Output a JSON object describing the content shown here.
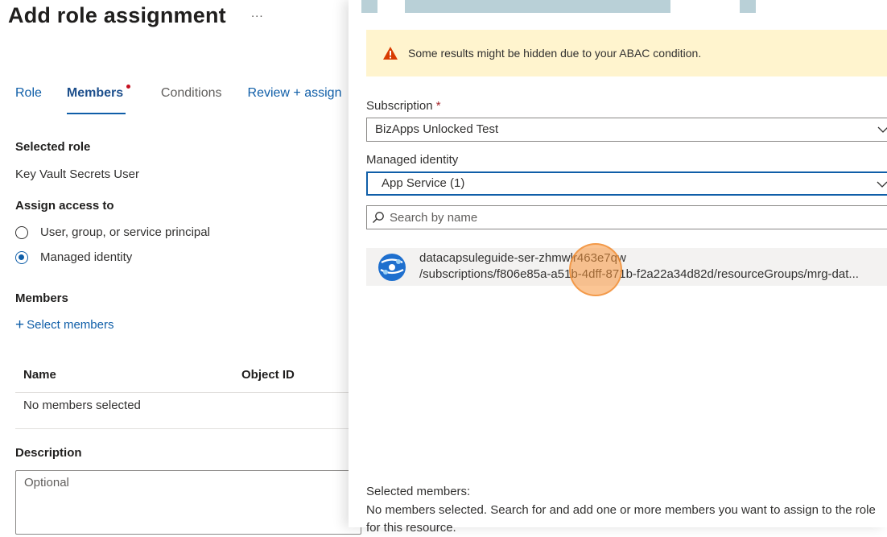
{
  "page": {
    "title": "Add role assignment",
    "more_label": "..."
  },
  "tabs": [
    {
      "label": "Role"
    },
    {
      "label": "Members"
    },
    {
      "label": "Conditions"
    },
    {
      "label": "Review + assign"
    }
  ],
  "selected_role": {
    "heading": "Selected role",
    "value": "Key Vault Secrets User"
  },
  "assign_access": {
    "heading": "Assign access to",
    "options": [
      {
        "label": "User, group, or service principal",
        "checked": false
      },
      {
        "label": "Managed identity",
        "checked": true
      }
    ]
  },
  "members": {
    "heading": "Members",
    "select_label": "Select members",
    "columns": [
      "Name",
      "Object ID"
    ],
    "empty_text": "No members selected"
  },
  "description": {
    "heading": "Description",
    "placeholder": "Optional"
  },
  "blade": {
    "warning": "Some results might be hidden due to your ABAC condition.",
    "subscription_label": "Subscription",
    "required_mark": "*",
    "subscription_value": "BizApps Unlocked Test",
    "identity_label": "Managed identity",
    "identity_value": "App Service (1)",
    "search_placeholder": "Search by name",
    "result": {
      "name": "datacapsuleguide-ser-zhmwlr463e7qw",
      "path": "/subscriptions/f806e85a-a51b-4dff-871b-f2a22a34d82d/resourceGroups/mrg-dat..."
    },
    "selected_members_label": "Selected members:",
    "selected_members_text": "No members selected. Search for and add one or more members you want to assign to the role for this resource."
  },
  "colors": {
    "accent": "#0f5ea8",
    "warning_bg": "#fff4ce",
    "warning_icon": "#d83b01",
    "required": "#a4262c",
    "result_bg": "#f3f2f1"
  },
  "icons": {
    "warning": "warning-triangle-icon",
    "chevron": "chevron-down-icon",
    "search": "search-icon",
    "app_service": "app-service-icon"
  }
}
